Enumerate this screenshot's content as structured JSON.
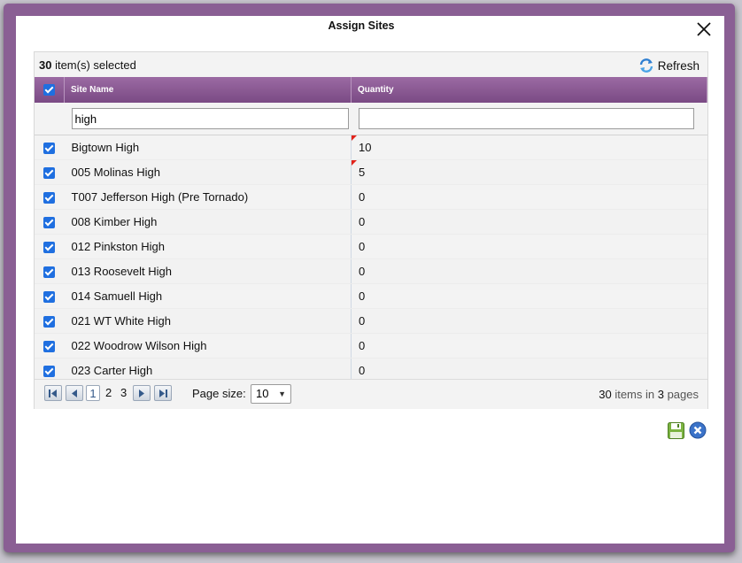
{
  "dialog": {
    "title": "Assign Sites"
  },
  "toolbar": {
    "selected_count": "30",
    "selected_suffix": " item(s) selected",
    "refresh_label": "Refresh"
  },
  "grid": {
    "columns": {
      "site_name": "Site Name",
      "quantity": "Quantity"
    },
    "filter": {
      "site_name_value": "high",
      "quantity_value": ""
    },
    "rows": [
      {
        "name": "Bigtown High",
        "quantity": "10",
        "checked": true,
        "edited": true
      },
      {
        "name": "005 Molinas High",
        "quantity": "5",
        "checked": true,
        "edited": true
      },
      {
        "name": "T007 Jefferson High (Pre Tornado)",
        "quantity": "0",
        "checked": true,
        "edited": false
      },
      {
        "name": "008 Kimber High",
        "quantity": "0",
        "checked": true,
        "edited": false
      },
      {
        "name": "012 Pinkston High",
        "quantity": "0",
        "checked": true,
        "edited": false
      },
      {
        "name": "013 Roosevelt High",
        "quantity": "0",
        "checked": true,
        "edited": false
      },
      {
        "name": "014 Samuell High",
        "quantity": "0",
        "checked": true,
        "edited": false
      },
      {
        "name": "021 WT White High",
        "quantity": "0",
        "checked": true,
        "edited": false
      },
      {
        "name": "022 Woodrow Wilson High",
        "quantity": "0",
        "checked": true,
        "edited": false
      },
      {
        "name": "023 Carter High",
        "quantity": "0",
        "checked": true,
        "edited": false
      }
    ]
  },
  "pager": {
    "pages": [
      "1",
      "2",
      "3"
    ],
    "current_page": "1",
    "page_size_label": "Page size:",
    "page_size": "10",
    "total_items": "30",
    "items_in_label": " items in ",
    "total_pages": "3",
    "pages_label": " pages"
  },
  "icons": {
    "close": "close-icon",
    "refresh": "refresh-icon",
    "save": "save-icon",
    "cancel": "cancel-icon"
  },
  "colors": {
    "header": "#8a5f94",
    "checkbox": "#1f6fe0",
    "edit_marker": "#e2231a"
  }
}
